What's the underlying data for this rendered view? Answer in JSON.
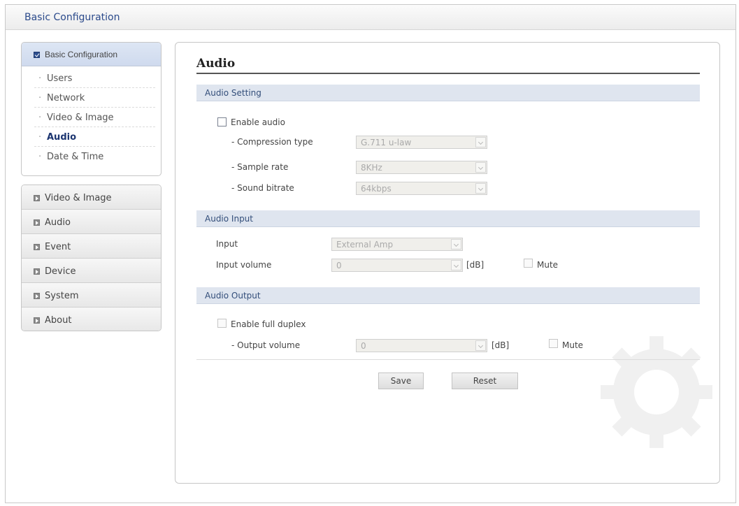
{
  "header": {
    "title": "Basic Configuration"
  },
  "sidebar": {
    "basic": {
      "label": "Basic Configuration",
      "items": [
        {
          "label": "Users"
        },
        {
          "label": "Network"
        },
        {
          "label": "Video & Image"
        },
        {
          "label": "Audio"
        },
        {
          "label": "Date & Time"
        }
      ]
    },
    "nav": [
      {
        "label": "Video & Image"
      },
      {
        "label": "Audio"
      },
      {
        "label": "Event"
      },
      {
        "label": "Device"
      },
      {
        "label": "System"
      },
      {
        "label": "About"
      }
    ]
  },
  "main": {
    "title": "Audio",
    "audio_setting": {
      "header": "Audio Setting",
      "enable_label": "Enable audio",
      "compression_label": "- Compression type",
      "compression_value": "G.711 u-law",
      "sample_label": "- Sample rate",
      "sample_value": "8KHz",
      "bitrate_label": "- Sound bitrate",
      "bitrate_value": "64kbps"
    },
    "audio_input": {
      "header": "Audio Input",
      "input_label": "Input",
      "input_value": "External Amp",
      "volume_label": "Input volume",
      "volume_value": "0",
      "unit": "[dB]",
      "mute_label": "Mute"
    },
    "audio_output": {
      "header": "Audio Output",
      "duplex_label": "Enable full duplex",
      "volume_label": "- Output volume",
      "volume_value": "0",
      "unit": "[dB]",
      "mute_label": "Mute"
    },
    "buttons": {
      "save": "Save",
      "reset": "Reset"
    }
  }
}
